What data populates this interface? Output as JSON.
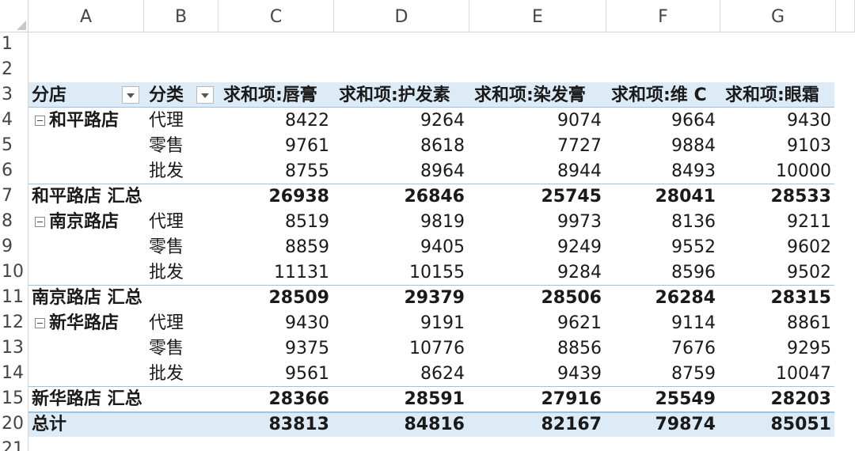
{
  "columns": [
    "A",
    "B",
    "C",
    "D",
    "E",
    "F",
    "G"
  ],
  "row_numbers": [
    "1",
    "2",
    "3",
    "4",
    "5",
    "6",
    "7",
    "8",
    "9",
    "10",
    "11",
    "12",
    "13",
    "14",
    "15",
    "20",
    "21"
  ],
  "pivot": {
    "header": {
      "store": "分店",
      "category": "分类",
      "measures": [
        "求和项:唇膏",
        "求和项:护发素",
        "求和项:染发膏",
        "求和项:维 C",
        "求和项:眼霜"
      ]
    },
    "groups": [
      {
        "store": "和平路店",
        "rows": [
          {
            "category": "代理",
            "values": [
              "8422",
              "9264",
              "9074",
              "9664",
              "9430"
            ]
          },
          {
            "category": "零售",
            "values": [
              "9761",
              "8618",
              "7727",
              "9884",
              "9103"
            ]
          },
          {
            "category": "批发",
            "values": [
              "8755",
              "8964",
              "8944",
              "8493",
              "10000"
            ]
          }
        ],
        "subtotal_label": "和平路店 汇总",
        "subtotal": [
          "26938",
          "26846",
          "25745",
          "28041",
          "28533"
        ]
      },
      {
        "store": "南京路店",
        "rows": [
          {
            "category": "代理",
            "values": [
              "8519",
              "9819",
              "9973",
              "8136",
              "9211"
            ]
          },
          {
            "category": "零售",
            "values": [
              "8859",
              "9405",
              "9249",
              "9552",
              "9602"
            ]
          },
          {
            "category": "批发",
            "values": [
              "11131",
              "10155",
              "9284",
              "8596",
              "9502"
            ]
          }
        ],
        "subtotal_label": "南京路店 汇总",
        "subtotal": [
          "28509",
          "29379",
          "28506",
          "26284",
          "28315"
        ]
      },
      {
        "store": "新华路店",
        "rows": [
          {
            "category": "代理",
            "values": [
              "9430",
              "9191",
              "9621",
              "9114",
              "8861"
            ]
          },
          {
            "category": "零售",
            "values": [
              "9375",
              "10776",
              "8856",
              "7676",
              "9295"
            ]
          },
          {
            "category": "批发",
            "values": [
              "9561",
              "8624",
              "9439",
              "8759",
              "10047"
            ]
          }
        ],
        "subtotal_label": "新华路店 汇总",
        "subtotal": [
          "28366",
          "28591",
          "27916",
          "25549",
          "28203"
        ]
      }
    ],
    "grand_total_label": "总计",
    "grand_total": [
      "83813",
      "84816",
      "82167",
      "79874",
      "85051"
    ]
  }
}
